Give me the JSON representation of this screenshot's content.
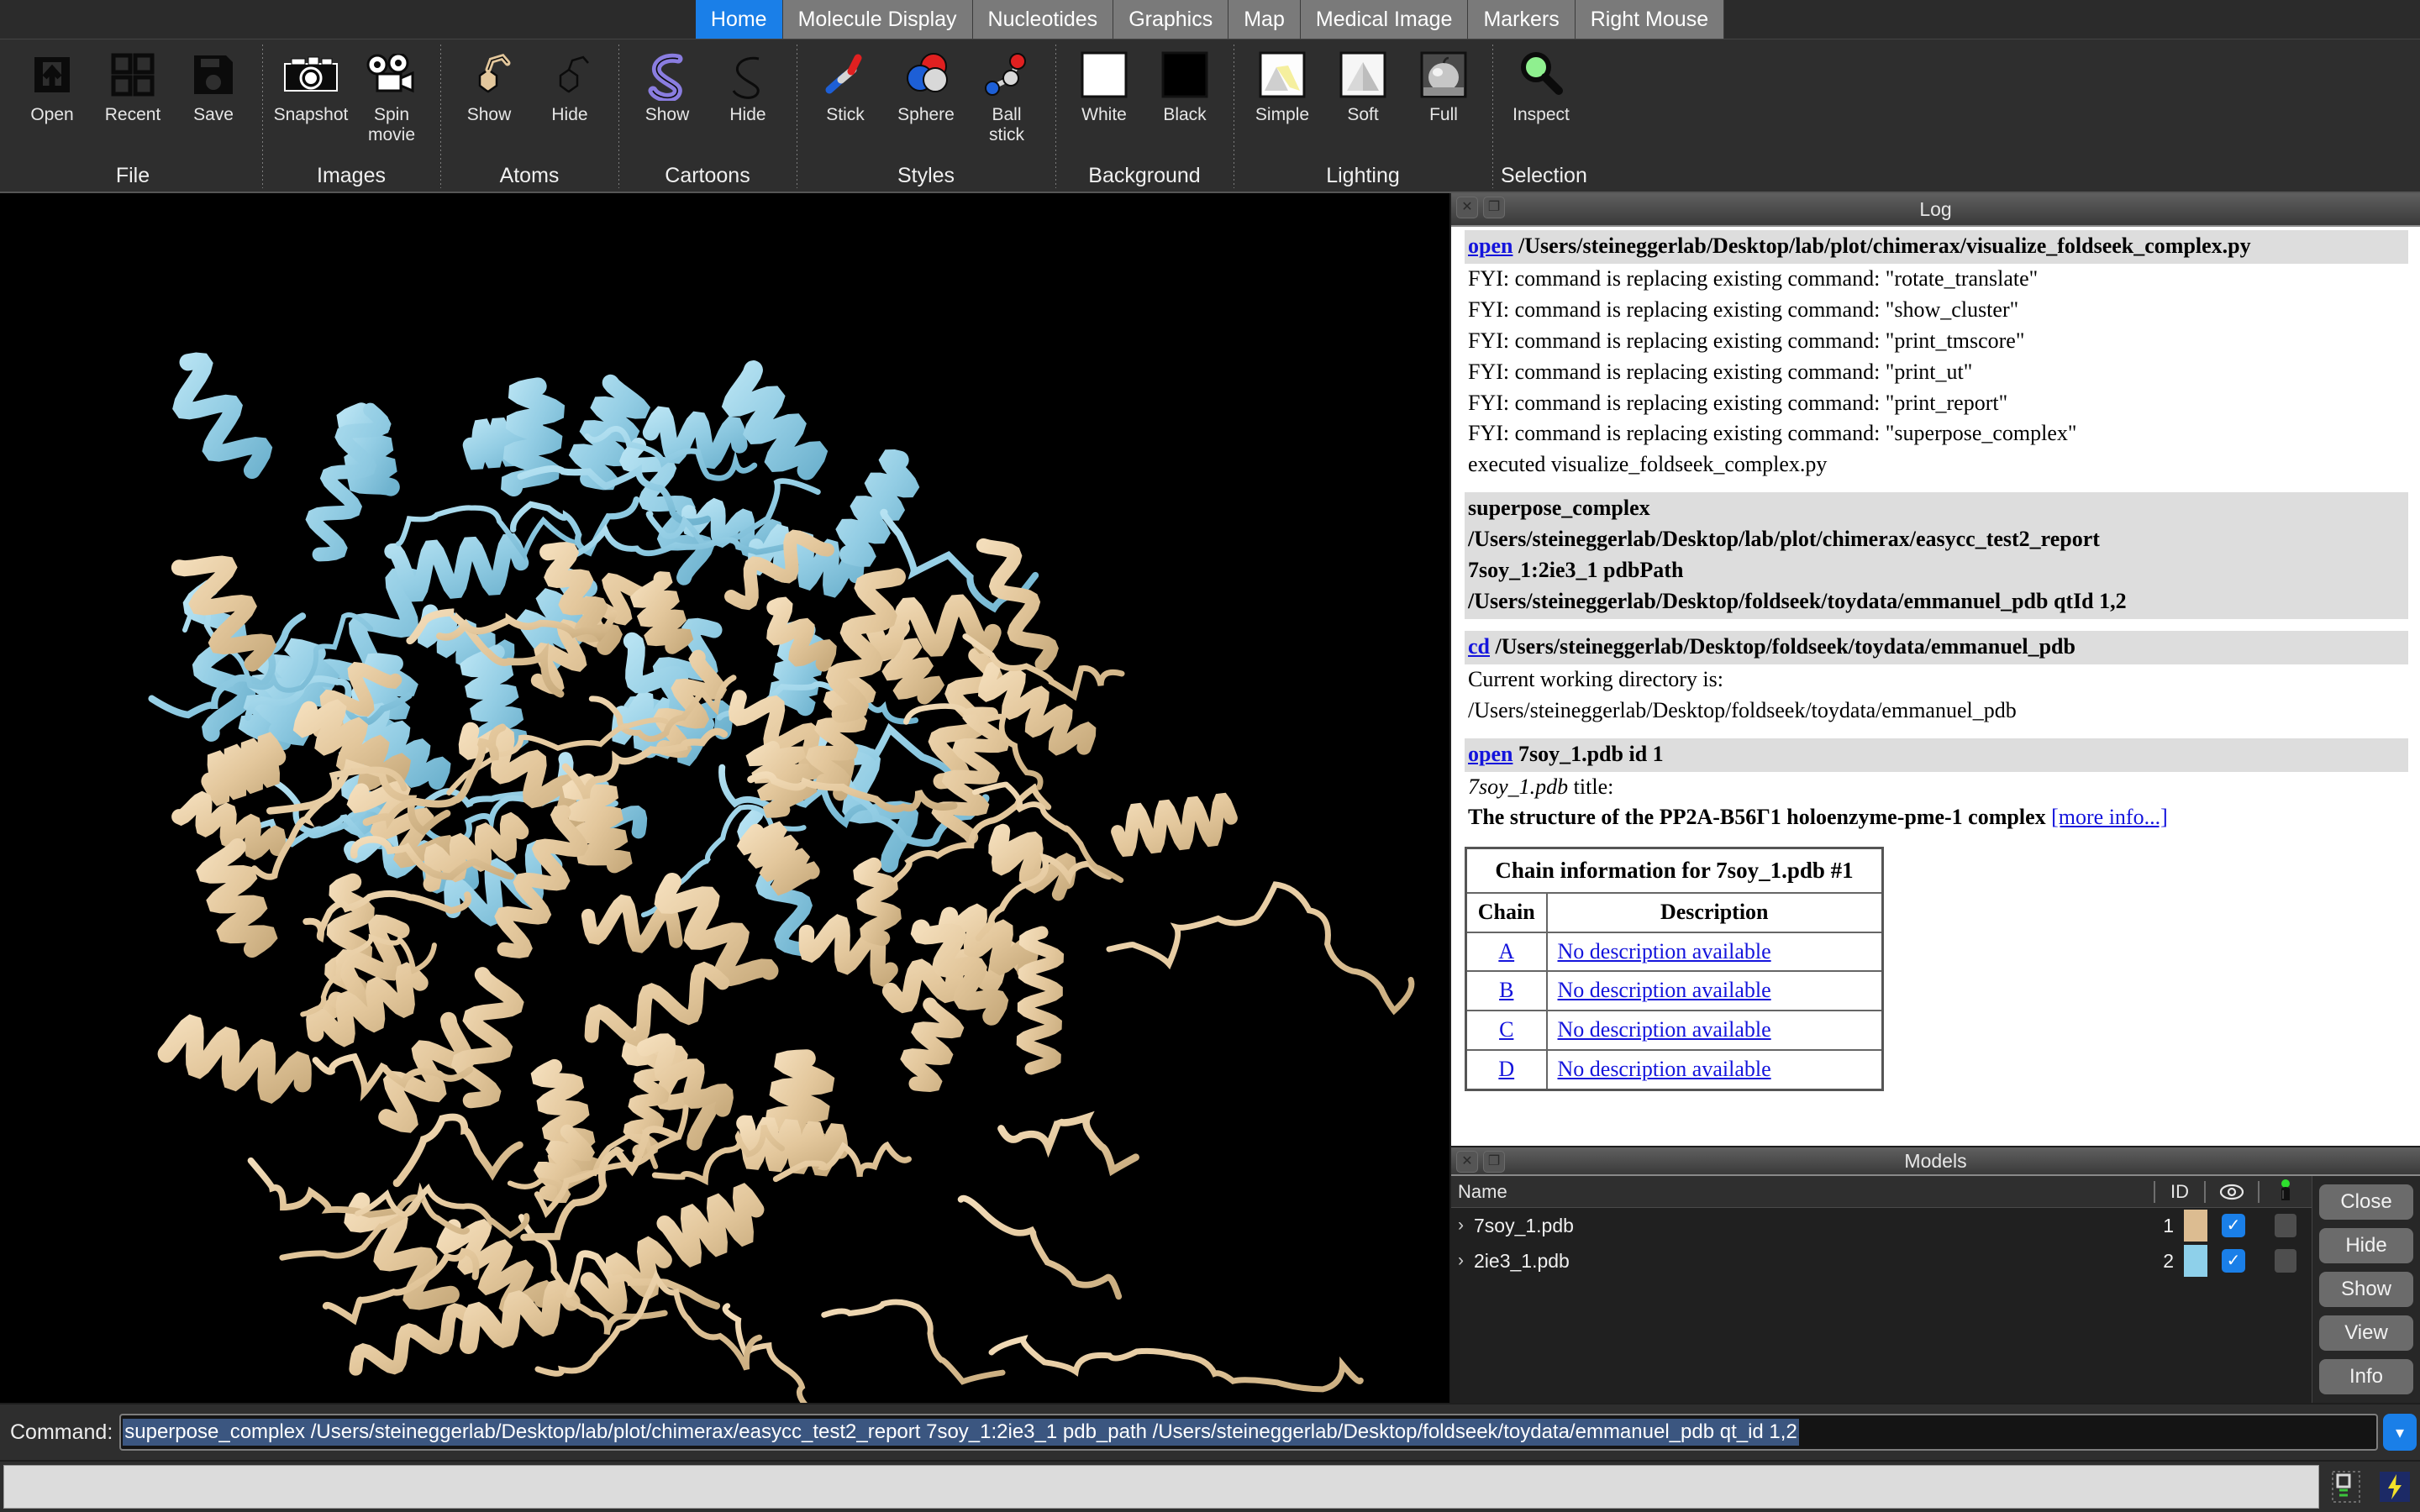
{
  "tabs": [
    {
      "label": "Home",
      "active": true
    },
    {
      "label": "Molecule Display",
      "active": false
    },
    {
      "label": "Nucleotides",
      "active": false
    },
    {
      "label": "Graphics",
      "active": false
    },
    {
      "label": "Map",
      "active": false
    },
    {
      "label": "Medical Image",
      "active": false
    },
    {
      "label": "Markers",
      "active": false
    },
    {
      "label": "Right Mouse",
      "active": false
    }
  ],
  "ribbon": {
    "groups": [
      {
        "title": "File",
        "items": [
          {
            "label": "Open",
            "icon": "open-icon"
          },
          {
            "label": "Recent",
            "icon": "recent-icon"
          },
          {
            "label": "Save",
            "icon": "save-icon"
          }
        ]
      },
      {
        "title": "Images",
        "items": [
          {
            "label": "Snapshot",
            "icon": "camera-icon"
          },
          {
            "label": "Spin\nmovie",
            "icon": "movie-camera-icon"
          }
        ]
      },
      {
        "title": "Atoms",
        "items": [
          {
            "label": "Show",
            "icon": "atoms-show-icon"
          },
          {
            "label": "Hide",
            "icon": "atoms-hide-icon"
          }
        ]
      },
      {
        "title": "Cartoons",
        "items": [
          {
            "label": "Show",
            "icon": "cartoon-show-icon"
          },
          {
            "label": "Hide",
            "icon": "cartoon-hide-icon"
          }
        ]
      },
      {
        "title": "Styles",
        "items": [
          {
            "label": "Stick",
            "icon": "stick-icon"
          },
          {
            "label": "Sphere",
            "icon": "sphere-icon"
          },
          {
            "label": "Ball\nstick",
            "icon": "ball-stick-icon"
          }
        ]
      },
      {
        "title": "Background",
        "items": [
          {
            "label": "White",
            "icon": "white-swatch-icon"
          },
          {
            "label": "Black",
            "icon": "black-swatch-icon"
          }
        ]
      },
      {
        "title": "Lighting",
        "items": [
          {
            "label": "Simple",
            "icon": "lighting-simple-icon"
          },
          {
            "label": "Soft",
            "icon": "lighting-soft-icon"
          },
          {
            "label": "Full",
            "icon": "lighting-full-icon"
          }
        ]
      },
      {
        "title": "Selection",
        "items": [
          {
            "label": "Inspect",
            "icon": "magnifier-icon"
          }
        ]
      }
    ]
  },
  "log": {
    "title": "Log",
    "entries": [
      {
        "kind": "cmd",
        "link": "open",
        "text": "/Users/steineggerlab/Desktop/lab/plot/chimerax/visualize_foldseek_complex.py"
      },
      {
        "kind": "plain",
        "text": "FYI: command is replacing existing command: \"rotate_translate\""
      },
      {
        "kind": "plain",
        "text": "FYI: command is replacing existing command: \"show_cluster\""
      },
      {
        "kind": "plain",
        "text": "FYI: command is replacing existing command: \"print_tmscore\""
      },
      {
        "kind": "plain",
        "text": "FYI: command is replacing existing command: \"print_ut\""
      },
      {
        "kind": "plain",
        "text": "FYI: command is replacing existing command: \"print_report\""
      },
      {
        "kind": "plain",
        "text": "FYI: command is replacing existing command: \"superpose_complex\""
      },
      {
        "kind": "plain",
        "text": "executed visualize_foldseek_complex.py"
      },
      {
        "kind": "gap"
      },
      {
        "kind": "cmdblock",
        "lines": [
          "superpose_complex",
          "/Users/steineggerlab/Desktop/lab/plot/chimerax/easycc_test2_report",
          "7soy_1:2ie3_1 pdbPath",
          "/Users/steineggerlab/Desktop/foldseek/toydata/emmanuel_pdb qtId 1,2"
        ]
      },
      {
        "kind": "gap"
      },
      {
        "kind": "cmd",
        "link": "cd",
        "text": "/Users/steineggerlab/Desktop/foldseek/toydata/emmanuel_pdb"
      },
      {
        "kind": "plain",
        "text": "Current working directory is:"
      },
      {
        "kind": "plain",
        "text": "/Users/steineggerlab/Desktop/foldseek/toydata/emmanuel_pdb"
      },
      {
        "kind": "gap"
      },
      {
        "kind": "cmd",
        "link": "open",
        "text": "7soy_1.pdb id 1"
      },
      {
        "kind": "italichead",
        "italic": "7soy_1.pdb",
        "rest": " title:"
      },
      {
        "kind": "boldtitle",
        "text": "The structure of the PP2A-B56Γ1 holoenzyme-pme-1 complex",
        "link": "[more info...]"
      }
    ],
    "chain_table": {
      "caption": "Chain information for 7soy_1.pdb #1",
      "headers": [
        "Chain",
        "Description"
      ],
      "rows": [
        {
          "chain": "A",
          "description": "No description available"
        },
        {
          "chain": "B",
          "description": "No description available"
        },
        {
          "chain": "C",
          "description": "No description available"
        },
        {
          "chain": "D",
          "description": "No description available"
        }
      ]
    }
  },
  "models": {
    "title": "Models",
    "columns": {
      "name": "Name",
      "id": "ID",
      "shown": "shown-eye-icon",
      "select": "select-pointer-icon"
    },
    "rows": [
      {
        "name": "7soy_1.pdb",
        "id": "1",
        "color": "#dcbc91",
        "shown": true,
        "selected": false
      },
      {
        "name": "2ie3_1.pdb",
        "id": "2",
        "color": "#8ed0ea",
        "shown": true,
        "selected": false
      }
    ],
    "buttons": [
      "Close",
      "Hide",
      "Show",
      "View",
      "Info"
    ]
  },
  "command": {
    "label": "Command:",
    "value": "superpose_complex /Users/steineggerlab/Desktop/lab/plot/chimerax/easycc_test2_report 7soy_1:2ie3_1 pdb_path /Users/steineggerlab/Desktop/foldseek/toydata/emmanuel_pdb qt_id 1,2",
    "dropdown_icon": "chevron-down-icon"
  },
  "status": {
    "text": "",
    "icons": [
      "resize-handle-icon",
      "lightning-icon"
    ]
  },
  "colors": {
    "accent": "#1a7fe8",
    "model_tan": "#e8cfa8",
    "model_blue": "#9dd4e8",
    "viewport_bg": "#000000",
    "ribbon_bg": "#2e2e2e",
    "log_bg": "#ffffff",
    "link": "#1414dc"
  }
}
